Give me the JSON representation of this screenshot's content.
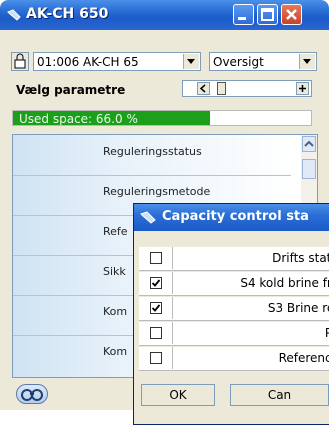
{
  "window": {
    "title": "AK-CH 650"
  },
  "toolbar": {
    "device_select": "01:006 AK-CH 65",
    "view_select": "Oversigt"
  },
  "params": {
    "label": "Vælg parametre"
  },
  "usage": {
    "text": "Used space: 66.0 %",
    "fraction": 0.66
  },
  "list": {
    "items": [
      "Reguleringsstatus",
      "Reguleringsmetode",
      "Refe",
      "Sikk",
      "Kom",
      "Kom"
    ]
  },
  "dialog": {
    "title": "Capacity control sta",
    "rows": [
      {
        "label": "Drifts statu",
        "checked": false
      },
      {
        "label": "S4 kold brine fre",
        "checked": true
      },
      {
        "label": "S3 Brine ret",
        "checked": true
      },
      {
        "label": "Po",
        "checked": false
      },
      {
        "label": "Reference",
        "checked": false
      }
    ],
    "ok_label": "OK",
    "cancel_label": "Can"
  },
  "colors": {
    "titlebar": "#2b6fd6",
    "used_fill": "#1ca01c",
    "close": "#c8442a"
  }
}
